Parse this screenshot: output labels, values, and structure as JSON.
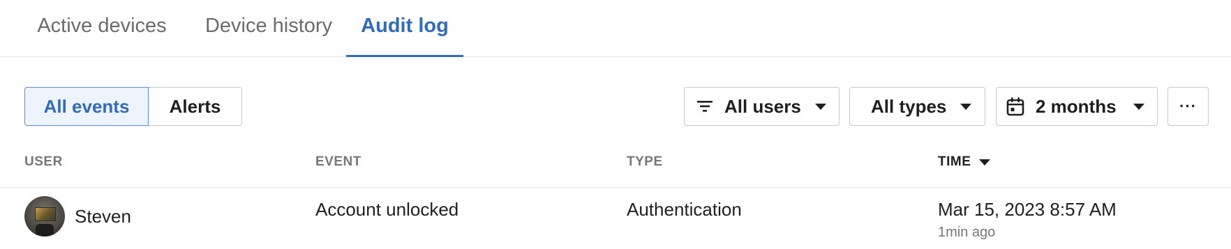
{
  "tabs": [
    {
      "label": "Active devices",
      "active": false
    },
    {
      "label": "Device history",
      "active": false
    },
    {
      "label": "Audit log",
      "active": true
    }
  ],
  "toolbar": {
    "segments": [
      {
        "label": "All events",
        "selected": true
      },
      {
        "label": "Alerts",
        "selected": false
      }
    ],
    "users_filter": {
      "label": "All users",
      "icon": "filter-icon"
    },
    "types_filter": {
      "label": "All types"
    },
    "range_filter": {
      "label": "2 months",
      "icon": "calendar-icon"
    },
    "more": {
      "label": "···",
      "icon": "more-icon"
    }
  },
  "table": {
    "columns": [
      {
        "label": "USER"
      },
      {
        "label": "EVENT"
      },
      {
        "label": "TYPE"
      },
      {
        "label": "TIME",
        "sorted": "desc"
      }
    ],
    "rows": [
      {
        "user": "Steven",
        "event": "Account unlocked",
        "type": "Authentication",
        "time": "Mar 15, 2023 8:57 AM",
        "relative": "1min ago"
      }
    ]
  },
  "colors": {
    "accent": "#2f6bbf",
    "text": "#1f1f1f",
    "muted": "#777777",
    "border": "#c9c9c9",
    "selected_bg": "#eef4fc"
  }
}
